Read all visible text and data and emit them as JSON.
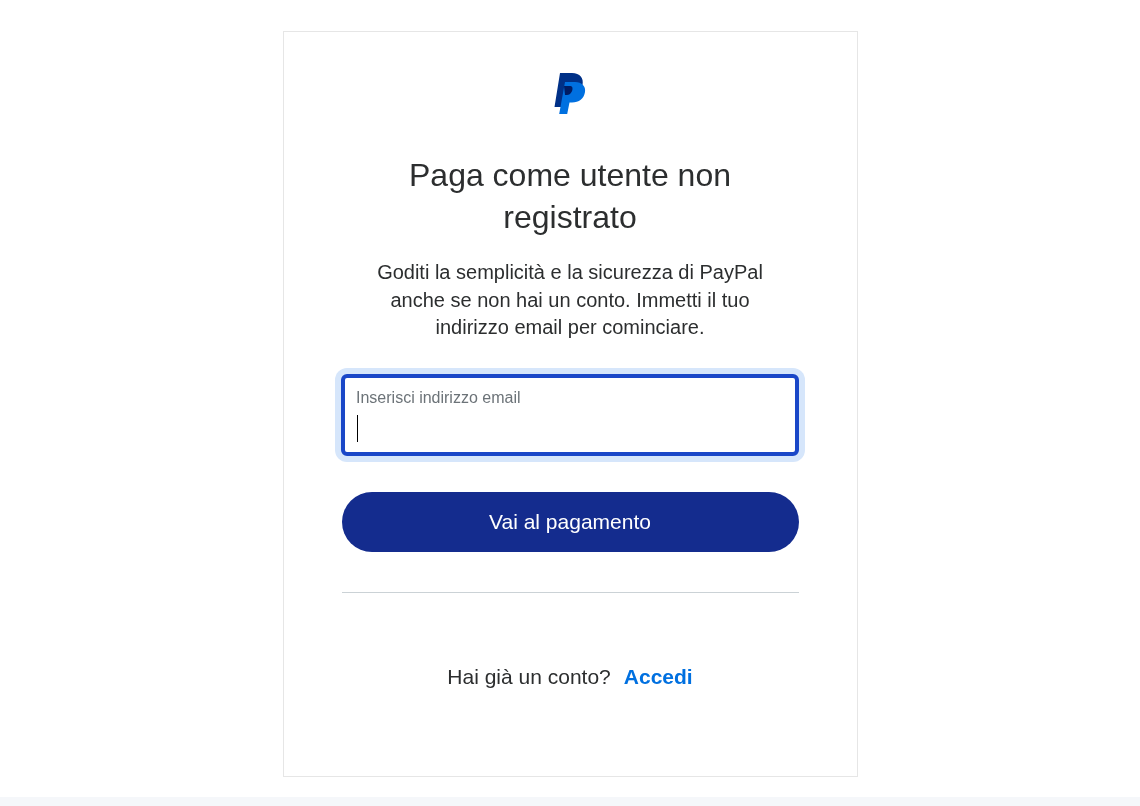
{
  "heading": "Paga come utente non registrato",
  "intro": "Goditi la semplicità e la sicurezza di PayPal anche se non hai un conto. Immetti il tuo indirizzo email per cominciare.",
  "email_field": {
    "label": "Inserisci indirizzo email",
    "focused": true
  },
  "continue_button": "Vai al pagamento",
  "login_prompt": {
    "text": "Hai già un conto?",
    "link": "Accedi"
  }
}
